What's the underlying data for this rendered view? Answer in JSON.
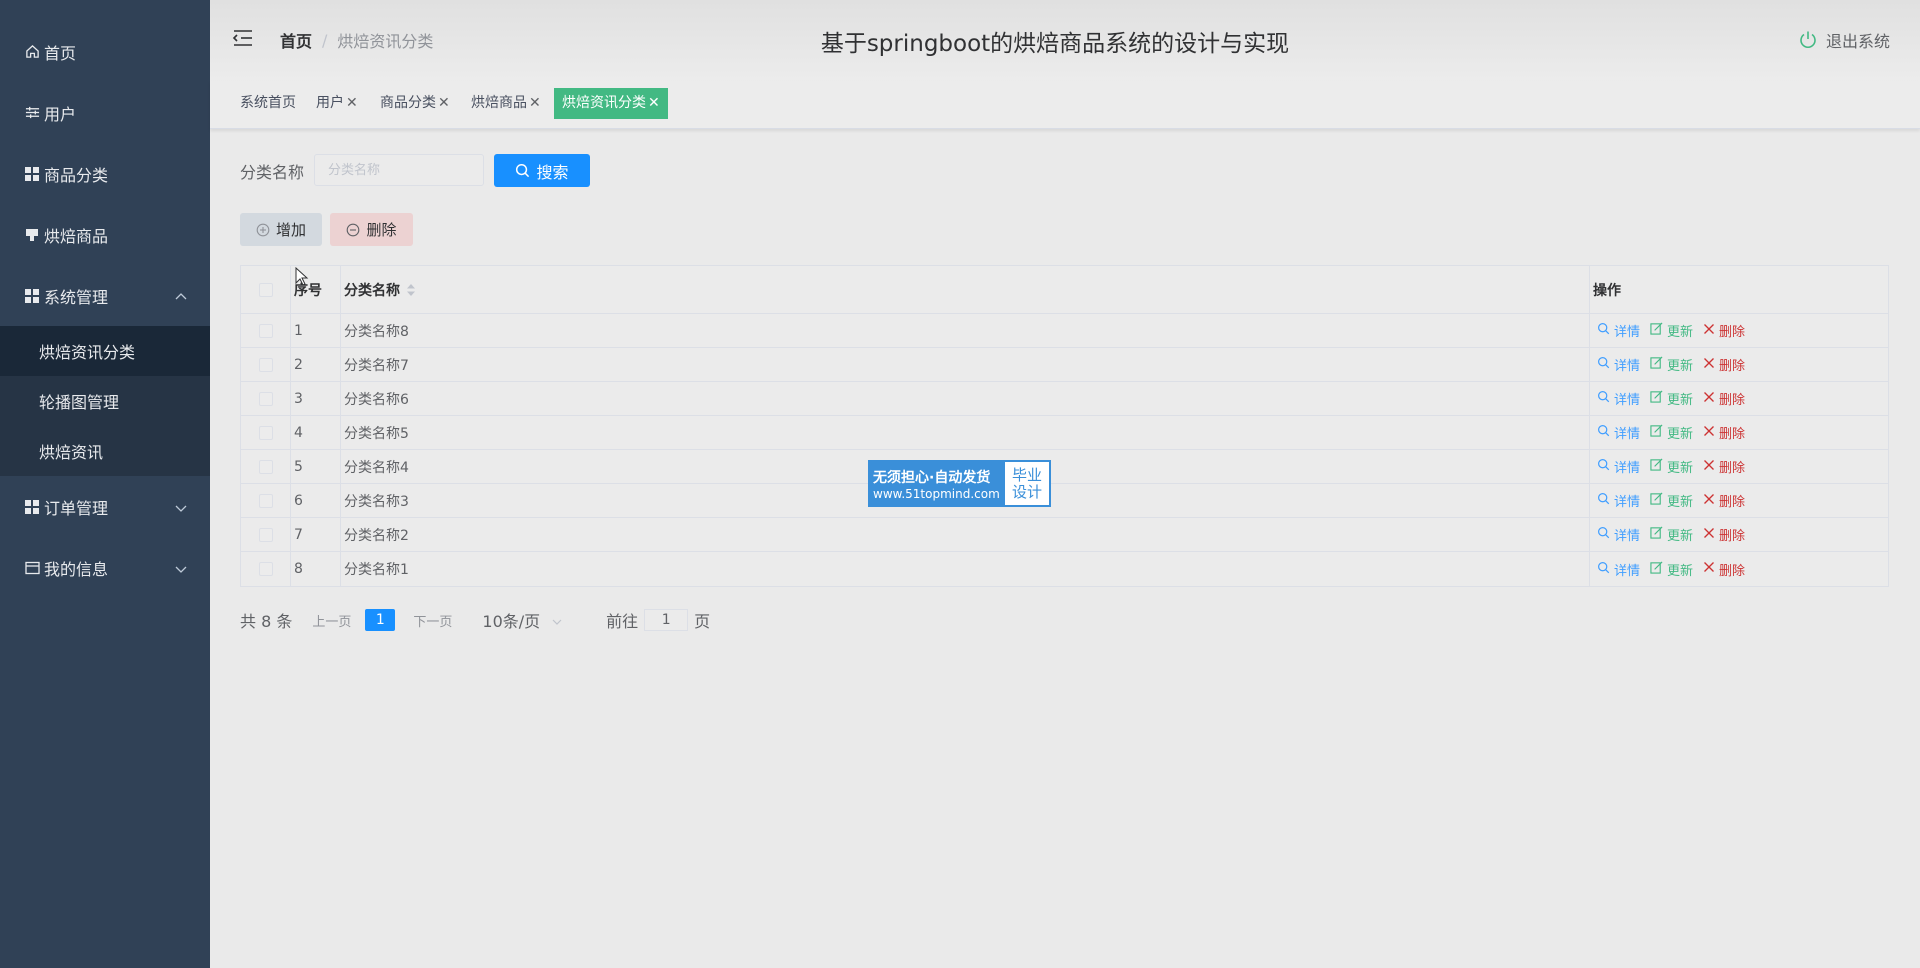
{
  "sidebar": {
    "items": [
      {
        "label": "首页",
        "icon": "home-icon"
      },
      {
        "label": "用户",
        "icon": "sliders-icon"
      },
      {
        "label": "商品分类",
        "icon": "grid-icon"
      },
      {
        "label": "烘焙商品",
        "icon": "goods-icon"
      },
      {
        "label": "系统管理",
        "icon": "grid-icon",
        "expanded": true,
        "children": [
          {
            "label": "烘焙资讯分类",
            "active": true
          },
          {
            "label": "轮播图管理"
          },
          {
            "label": "烘焙资讯"
          }
        ]
      },
      {
        "label": "订单管理",
        "icon": "grid-icon"
      },
      {
        "label": "我的信息",
        "icon": "card-icon"
      }
    ]
  },
  "header": {
    "breadcrumb_home": "首页",
    "breadcrumb_sep": "/",
    "breadcrumb_current": "烘焙资讯分类",
    "title": "基于springboot的烘焙商品系统的设计与实现",
    "logout": "退出系统"
  },
  "tabs": [
    {
      "label": "系统首页",
      "closable": false
    },
    {
      "label": "用户",
      "closable": true
    },
    {
      "label": "商品分类",
      "closable": true
    },
    {
      "label": "烘焙商品",
      "closable": true
    },
    {
      "label": "烘焙资讯分类",
      "closable": true,
      "active": true
    }
  ],
  "tab_close": "✕",
  "search": {
    "label": "分类名称",
    "placeholder": "分类名称",
    "button": "搜索"
  },
  "actions": {
    "add": "增加",
    "delete": "删除"
  },
  "table": {
    "columns": {
      "index": "序号",
      "name": "分类名称",
      "ops": "操作"
    },
    "rows": [
      {
        "index": "1",
        "name": "分类名称8"
      },
      {
        "index": "2",
        "name": "分类名称7"
      },
      {
        "index": "3",
        "name": "分类名称6"
      },
      {
        "index": "4",
        "name": "分类名称5"
      },
      {
        "index": "5",
        "name": "分类名称4"
      },
      {
        "index": "6",
        "name": "分类名称3"
      },
      {
        "index": "7",
        "name": "分类名称2"
      },
      {
        "index": "8",
        "name": "分类名称1"
      }
    ],
    "op_labels": {
      "detail": "详情",
      "update": "更新",
      "remove": "删除"
    }
  },
  "pager": {
    "total": "共 8 条",
    "prev": "上一页",
    "current": "1",
    "next": "下一页",
    "size": "10条/页",
    "goto_prefix": "前往",
    "goto_value": "1",
    "goto_suffix": "页"
  },
  "watermark": {
    "line1": "无须担心·自动发货",
    "line2": "www.51topmind.com",
    "right1": "毕业",
    "right2": "设计"
  },
  "colors": {
    "sidebar": "#304156",
    "primary": "#1890ff",
    "tab_active": "#42b983",
    "danger": "#cc3333"
  }
}
